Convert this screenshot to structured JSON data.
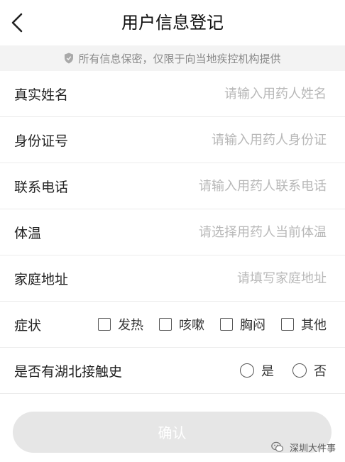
{
  "header": {
    "title": "用户信息登记"
  },
  "notice": {
    "text": "所有信息保密，仅限于向当地疾控机构提供"
  },
  "form": {
    "name": {
      "label": "真实姓名",
      "placeholder": "请输入用药人姓名"
    },
    "id_number": {
      "label": "身份证号",
      "placeholder": "请输入用药人身份证"
    },
    "phone": {
      "label": "联系电话",
      "placeholder": "请输入用药人联系电话"
    },
    "temperature": {
      "label": "体温",
      "placeholder": "请选择用药人当前体温"
    },
    "address": {
      "label": "家庭地址",
      "placeholder": "请填写家庭地址"
    },
    "symptoms": {
      "label": "症状",
      "options": [
        "发热",
        "咳嗽",
        "胸闷",
        "其他"
      ]
    },
    "hubei_contact": {
      "label": "是否有湖北接触史",
      "options": [
        "是",
        "否"
      ]
    }
  },
  "confirm": {
    "label": "确认"
  },
  "watermark": {
    "text": "深圳大件事"
  },
  "colors": {
    "notice_bg": "#f3f3f3",
    "placeholder": "#b8b8b8",
    "button_disabled": "#e6e6e6"
  }
}
